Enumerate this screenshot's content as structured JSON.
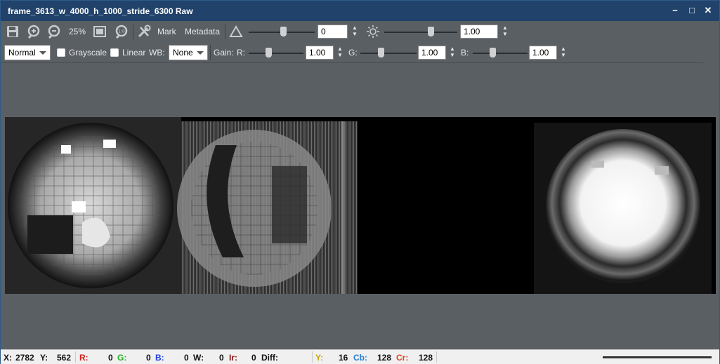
{
  "window": {
    "title": "frame_3613_w_4000_h_1000_stride_6300 Raw"
  },
  "window_controls": {
    "minimize": "−",
    "maximize": "□",
    "close": "✕"
  },
  "toolbar1": {
    "zoom_percent": "25%",
    "mark_label": "Mark",
    "metadata_label": "Metadata",
    "exposure_value": "0",
    "brightness_value": "1.00"
  },
  "toolbar2": {
    "blend_mode": "Normal",
    "grayscale_label": "Grayscale",
    "grayscale_checked": false,
    "linear_label": "Linear",
    "linear_checked": false,
    "wb_label": "WB:",
    "wb_value": "None",
    "gain_label": "Gain:",
    "r_label": "R:",
    "r_value": "1.00",
    "g_label": "G:",
    "g_value": "1.00",
    "b_label": "B:",
    "b_value": "1.00"
  },
  "status": {
    "x_label": "X:",
    "x_value": "2782",
    "y_label": "Y:",
    "y_value": "562",
    "r_label": "R:",
    "r_value": "0",
    "g_label": "G:",
    "g_value": "0",
    "b_label": "B:",
    "b_value": "0",
    "w_label": "W:",
    "w_value": "0",
    "ir_label": "Ir:",
    "ir_value": "0",
    "diff_label": "Diff:",
    "yy_label": "Y:",
    "yy_value": "16",
    "cb_label": "Cb:",
    "cb_value": "128",
    "cr_label": "Cr:",
    "cr_value": "128"
  },
  "colors": {
    "titlebar": "#21426a",
    "panel": "#5a5f64",
    "status_r": "#d42020",
    "status_g": "#22b422",
    "status_b": "#2040e0",
    "status_ir": "#8a1010",
    "status_y": "#c8a800",
    "status_cb": "#2a7fd4",
    "status_cr": "#e04020"
  }
}
